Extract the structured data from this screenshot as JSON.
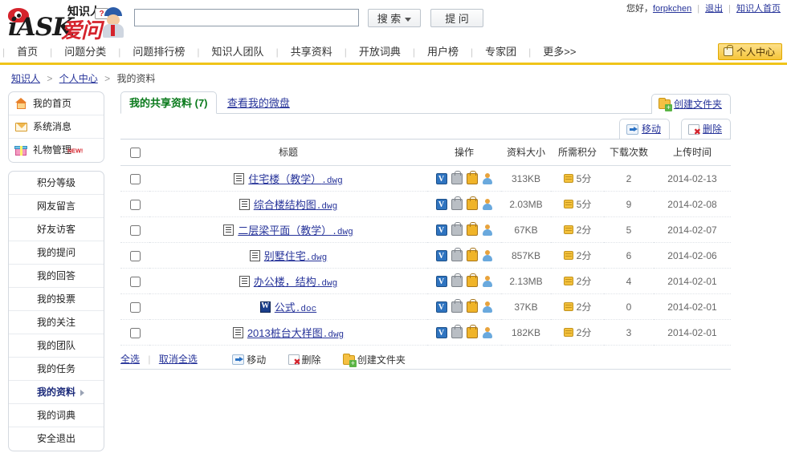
{
  "header": {
    "logo": {
      "ask_text": "iASK",
      "brand_cn": "爱问",
      "sub_cn": "知识人",
      "bubble": "?"
    },
    "search": {
      "value": "",
      "placeholder": ""
    },
    "search_button": "搜 索",
    "ask_button": "提 问",
    "greeting": "您好，",
    "username": "forpkchen",
    "logout": "退出",
    "home_link": "知识人首页"
  },
  "nav": {
    "items": [
      {
        "label": "首页"
      },
      {
        "label": "问题分类"
      },
      {
        "label": "问题排行榜"
      },
      {
        "label": "知识人团队"
      },
      {
        "label": "共享资料"
      },
      {
        "label": "开放词典"
      },
      {
        "label": "用户榜"
      },
      {
        "label": "专家团"
      },
      {
        "label": "更多>>"
      }
    ],
    "badge": "个人中心"
  },
  "breadcrumb": {
    "items": [
      "知识人",
      "个人中心",
      "我的资料"
    ],
    "arrow": ">"
  },
  "sidebar": {
    "top_items": [
      {
        "label": "我的首页",
        "icon": "home-icon",
        "badge": ""
      },
      {
        "label": "系统消息",
        "icon": "mail-icon",
        "badge": ""
      },
      {
        "label": "礼物管理",
        "icon": "gift-icon",
        "badge": "NEW!"
      }
    ],
    "items": [
      {
        "label": "积分等级",
        "active": false
      },
      {
        "label": "网友留言",
        "active": false
      },
      {
        "label": "好友访客",
        "active": false
      },
      {
        "label": "我的提问",
        "active": false
      },
      {
        "label": "我的回答",
        "active": false
      },
      {
        "label": "我的投票",
        "active": false
      },
      {
        "label": "我的关注",
        "active": false
      },
      {
        "label": "我的团队",
        "active": false
      },
      {
        "label": "我的任务",
        "active": false
      },
      {
        "label": "我的资料",
        "active": true
      },
      {
        "label": "我的词典",
        "active": false
      },
      {
        "label": "安全退出",
        "active": false
      }
    ]
  },
  "main": {
    "tabs": [
      {
        "label": "我的共享资料 (7)",
        "active": true
      },
      {
        "label": "查看我的微盘",
        "active": false
      }
    ],
    "create_folder_top": "创建文件夹",
    "move_top": "移动",
    "delete_top": "删除",
    "columns": {
      "title": "标题",
      "operation": "操作",
      "size": "资料大小",
      "points": "所需积分",
      "downloads": "下载次数",
      "uptime": "上传时间"
    },
    "rows": [
      {
        "name": "住宅楼（教学）",
        "ext": ".dwg",
        "type": "dwg",
        "size": "313KB",
        "points": "5分",
        "downloads": "2",
        "uptime": "2014-02-13"
      },
      {
        "name": "综合楼结构图",
        "ext": ".dwg",
        "type": "dwg",
        "size": "2.03MB",
        "points": "5分",
        "downloads": "9",
        "uptime": "2014-02-08"
      },
      {
        "name": "二层梁平面（教学）",
        "ext": ".dwg",
        "type": "dwg",
        "size": "67KB",
        "points": "2分",
        "downloads": "5",
        "uptime": "2014-02-07"
      },
      {
        "name": "别墅住宅",
        "ext": ".dwg",
        "type": "dwg",
        "size": "857KB",
        "points": "2分",
        "downloads": "6",
        "uptime": "2014-02-06"
      },
      {
        "name": "办公楼，结构",
        "ext": ".dwg",
        "type": "dwg",
        "size": "2.13MB",
        "points": "2分",
        "downloads": "4",
        "uptime": "2014-02-01"
      },
      {
        "name": "公式",
        "ext": ".doc",
        "type": "doc",
        "size": "37KB",
        "points": "2分",
        "downloads": "0",
        "uptime": "2014-02-01"
      },
      {
        "name": "2013桩台大样图",
        "ext": ".dwg",
        "type": "dwg",
        "size": "182KB",
        "points": "2分",
        "downloads": "3",
        "uptime": "2014-02-01"
      }
    ],
    "bottom": {
      "select_all": "全选",
      "unselect_all": "取消全选",
      "move": "移动",
      "delete": "删除",
      "create_folder": "创建文件夹"
    }
  },
  "colors": {
    "accent_yellow": "#f0c419",
    "link_blue": "#27349a",
    "tab_green": "#0a7a1c",
    "brand_red": "#d5232c"
  }
}
